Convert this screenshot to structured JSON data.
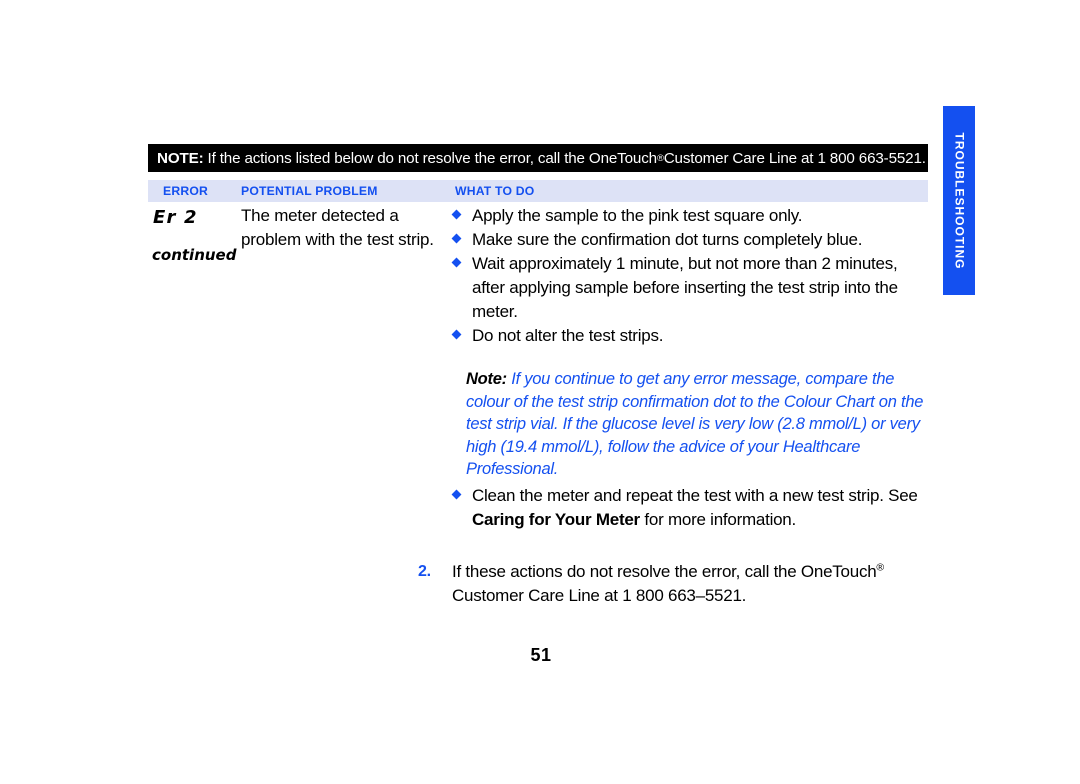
{
  "note_bar": {
    "label": "NOTE:",
    "text_before_mark": " If the actions listed below do not resolve the error, call the OneTouch",
    "trademark": "®",
    "text_after_mark": " Customer Care Line at 1 800 663-5521."
  },
  "column_headers": {
    "error": "ERROR",
    "potential_problem": "POTENTIAL PROBLEM",
    "what_to_do": "WHAT TO DO"
  },
  "error_column": {
    "code": "Er  2",
    "continued": "continued"
  },
  "problem_column": {
    "text": "The meter detected a problem with the test strip."
  },
  "what_to_do": {
    "bullets": [
      "Apply the sample to the pink test square only.",
      "Make sure the confirmation dot turns completely blue.",
      "Wait approximately 1 minute, but not more than 2 minutes, after applying sample before inserting the test strip into the meter.",
      "Do not alter the test strips."
    ]
  },
  "blue_note": {
    "label": "Note:",
    "text": " If you continue to get any error message, compare the colour of the test strip confirmation dot to the Colour Chart on the test strip vial. If the glucose level is very low (2.8 mmol/L) or very high (19.4 mmol/L), follow the advice of your Healthcare Professional."
  },
  "clean_bullet": {
    "part1": "Clean the meter and repeat the test with a new test strip. See ",
    "emphasis": "Caring for Your Meter",
    "part2": " for more information."
  },
  "item_two": {
    "number": "2.",
    "text_before_mark": "If these actions do not resolve the error, call the OneTouch",
    "trademark": "®",
    "text_after_mark": " Customer Care Line at 1 800 663–5521."
  },
  "page_number": "51",
  "side_tab": {
    "label": "TROUBLESHOOTING"
  },
  "colors": {
    "accent_blue": "#1450f0",
    "header_strip": "#dde2f6",
    "note_bar_bg": "#000000"
  }
}
